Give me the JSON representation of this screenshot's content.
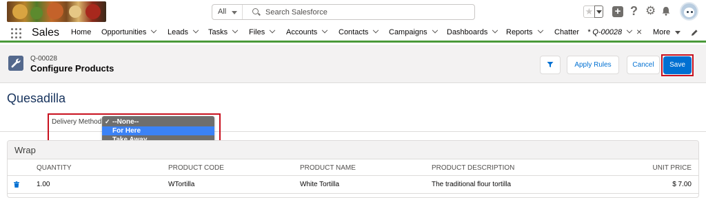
{
  "search": {
    "scope": "All",
    "placeholder": "Search Salesforce"
  },
  "nav": {
    "app_name": "Sales",
    "items": [
      {
        "label": "Home"
      },
      {
        "label": "Opportunities"
      },
      {
        "label": "Leads"
      },
      {
        "label": "Tasks"
      },
      {
        "label": "Files"
      },
      {
        "label": "Accounts"
      },
      {
        "label": "Contacts"
      },
      {
        "label": "Campaigns"
      },
      {
        "label": "Dashboards"
      },
      {
        "label": "Reports"
      },
      {
        "label": "Chatter"
      }
    ],
    "active_tab": "* Q-00028",
    "more": "More"
  },
  "page_header": {
    "record_id": "Q-00028",
    "title": "Configure Products",
    "apply_rules": "Apply Rules",
    "cancel": "Cancel",
    "save": "Save"
  },
  "product": {
    "name": "Quesadilla",
    "delivery_label": "Delivery Method",
    "options": [
      "--None--",
      "For Here",
      "Take Away"
    ],
    "checked_option": "--None--",
    "highlighted_option": "For Here"
  },
  "wrap": {
    "title": "Wrap",
    "columns": [
      "QUANTITY",
      "PRODUCT CODE",
      "PRODUCT NAME",
      "PRODUCT DESCRIPTION",
      "UNIT PRICE"
    ],
    "rows": [
      {
        "quantity": "1.00",
        "code": "WTortilla",
        "name": "White Tortilla",
        "description": "The traditional flour tortilla",
        "price": "$ 7.00"
      }
    ]
  },
  "colors": {
    "accent": "#0070d2",
    "nav_underline": "#4a9a39",
    "highlight_box": "#c8101e"
  }
}
